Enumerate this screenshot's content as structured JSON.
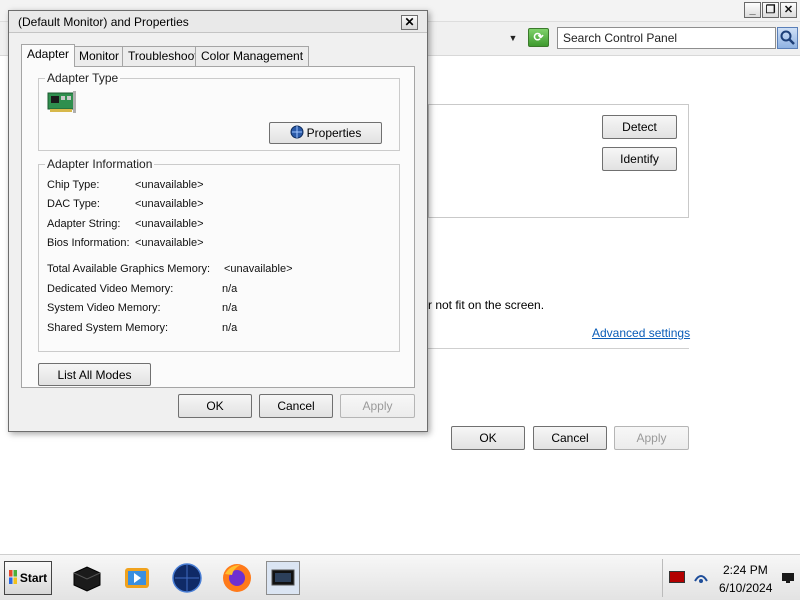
{
  "background_window": {
    "search_placeholder": "Search Control Panel",
    "detect_label": "Detect",
    "identify_label": "Identify",
    "fit_text": "r not fit on the screen.",
    "advanced_link": "Advanced settings",
    "ok_label": "OK",
    "cancel_label": "Cancel",
    "apply_label": "Apply"
  },
  "dialog": {
    "title": "(Default Monitor) and  Properties",
    "close_glyph": "✕",
    "tabs": [
      {
        "label": "Adapter",
        "active": true
      },
      {
        "label": "Monitor",
        "active": false
      },
      {
        "label": "Troubleshoot",
        "active": false
      },
      {
        "label": "Color Management",
        "active": false
      }
    ],
    "adapter_type": {
      "legend": "Adapter Type",
      "properties_label": "Properties"
    },
    "adapter_info": {
      "legend": "Adapter Information",
      "rows": [
        {
          "label": "Chip Type:",
          "value": "<unavailable>"
        },
        {
          "label": "DAC Type:",
          "value": "<unavailable>"
        },
        {
          "label": "Adapter String:",
          "value": "<unavailable>"
        },
        {
          "label": "Bios Information:",
          "value": "<unavailable>"
        }
      ],
      "memory_rows": [
        {
          "label": "Total Available Graphics Memory:",
          "value": "<unavailable>"
        },
        {
          "label": "Dedicated Video Memory:",
          "value": "n/a"
        },
        {
          "label": "System Video Memory:",
          "value": "n/a"
        },
        {
          "label": "Shared System Memory:",
          "value": "n/a"
        }
      ]
    },
    "list_all_modes_label": "List All Modes",
    "ok_label": "OK",
    "cancel_label": "Cancel",
    "apply_label": "Apply"
  },
  "taskbar": {
    "start_label": "Start",
    "apps": [
      "media-player-icon",
      "video-player-icon",
      "browser-globe-icon",
      "firefox-icon",
      "display-settings-icon"
    ],
    "clock_time": "2:24 PM",
    "clock_date": "6/10/2024"
  },
  "colors": {
    "link": "#0a5db8",
    "disabled_text": "#9a9a9a"
  }
}
